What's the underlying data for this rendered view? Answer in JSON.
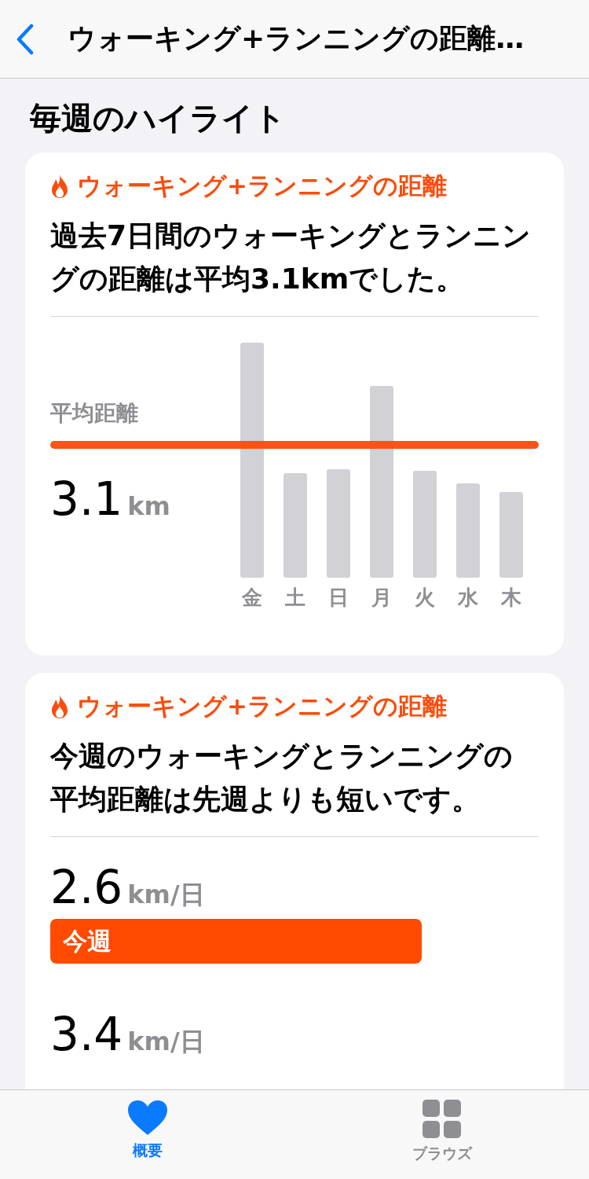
{
  "nav": {
    "title": "ウォーキング+ランニングの距離…"
  },
  "section_title": "毎週のハイライト",
  "cards": [
    {
      "kind": "chart",
      "category": "ウォーキング+ランニングの距離",
      "summary": "過去7日間のウォーキングとランニングの距離は平均3.1kmでした。",
      "average_label": "平均距離",
      "average_value": "3.1",
      "average_unit": "km",
      "days": [
        "金",
        "土",
        "日",
        "月",
        "火",
        "水",
        "木"
      ]
    },
    {
      "kind": "comparison",
      "category": "ウォーキング+ランニングの距離",
      "summary": "今週のウォーキングとランニングの平均距離は先週よりも短いです。",
      "rows": [
        {
          "value": "2.6",
          "unit": "km/日",
          "label": "今週"
        },
        {
          "value": "3.4",
          "unit": "km/日"
        }
      ]
    }
  ],
  "tab_bar": [
    {
      "label": "概要",
      "selected": true
    },
    {
      "label": "ブラウズ",
      "selected": false
    }
  ]
}
